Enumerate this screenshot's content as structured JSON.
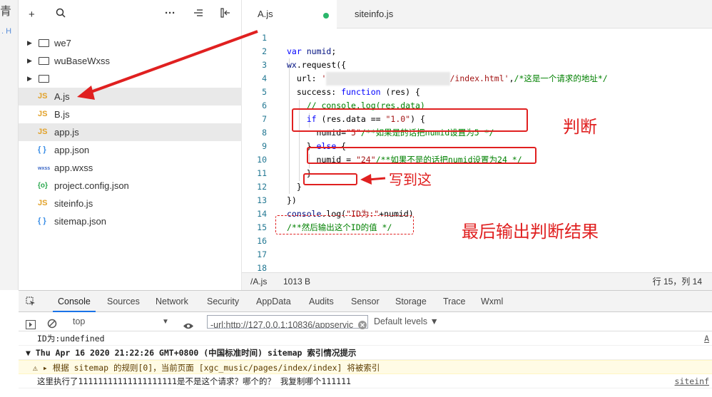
{
  "explorer": {
    "toolbar": {
      "add": "+",
      "search": "⌕",
      "more": "···",
      "sort": "⇐",
      "collapse": "⇤"
    },
    "items": [
      {
        "type": "folder",
        "label": "we7"
      },
      {
        "type": "folder",
        "label": "wuBaseWxss"
      },
      {
        "type": "folder",
        "label": ""
      },
      {
        "type": "file",
        "icon": "JS",
        "label": "A.js",
        "selected": true
      },
      {
        "type": "file",
        "icon": "JS",
        "label": "B.js"
      },
      {
        "type": "file",
        "icon": "JS",
        "label": "app.js",
        "selected": true
      },
      {
        "type": "file",
        "icon": "{ }",
        "label": "app.json"
      },
      {
        "type": "file",
        "icon": "wxss",
        "label": "app.wxss"
      },
      {
        "type": "file",
        "icon": "{o}",
        "label": "project.config.json"
      },
      {
        "type": "file",
        "icon": "JS",
        "label": "siteinfo.js"
      },
      {
        "type": "file",
        "icon": "{ }",
        "label": "sitemap.json"
      }
    ]
  },
  "tabs": [
    {
      "label": "A.js",
      "active": true,
      "modified": true
    },
    {
      "label": "siteinfo.js",
      "active": false
    }
  ],
  "editor": {
    "line_numbers": [
      "1",
      "2",
      "3",
      "4",
      "5",
      "6",
      "7",
      "8",
      "9",
      "10",
      "11",
      "12",
      "13",
      "14",
      "15",
      "16",
      "17",
      "18"
    ],
    "lines": [
      "",
      "var numid;",
      "wx.request({",
      "  url: '[blurred]/index.html',/*这是一个请求的地址*/",
      "  success: function (res) {",
      "    // console.log(res.data)",
      "    if (res.data == \"1.0\") {",
      "      numid=\"5\"/**如果是的话把numid设置为5 */",
      "    } else {",
      "      numid = \"24\"/**如果不是的话把numid设置为24 */",
      "    }",
      "  }",
      "})",
      "console.log(\"ID为:\"+numid)",
      "/**然后输出这个ID的值 */",
      "",
      "",
      ""
    ]
  },
  "annotations": {
    "judge": "判断",
    "write_here": "写到这",
    "final": "最后输出判断结果"
  },
  "statusbar": {
    "path": "/A.js",
    "size": "1013 B",
    "position": "行 15，列 14"
  },
  "devtools": {
    "tabs": [
      "Console",
      "Sources",
      "Network",
      "Security",
      "AppData",
      "Audits",
      "Sensor",
      "Storage",
      "Trace",
      "Wxml"
    ],
    "active_tab": "Console",
    "context": "top",
    "filter_value": "-url:http://127.0.0.1:10836/appservic",
    "levels": "Default levels ▼",
    "console": [
      {
        "text": "ID为:undefined",
        "source": "A"
      },
      {
        "text": "▼ Thu Apr 16 2020 21:22:26 GMT+0800 (中国标准时间) sitemap 索引情况提示",
        "bold": true
      },
      {
        "text": "⚠ ▸ 根据 sitemap 的规则[0]，当前页面 [xgc_music/pages/index/index] 将被索引",
        "warn": true
      },
      {
        "text": "这里执行了11111111111111111111是不是这个请求？哪个的？ 我复制哪个111111",
        "source": "siteinf"
      }
    ]
  },
  "colors": {
    "accent": "#1a73e8",
    "annotation_red": "#e02020",
    "js_icon": "#e2a22a",
    "modified_dot": "#2ab66b"
  }
}
